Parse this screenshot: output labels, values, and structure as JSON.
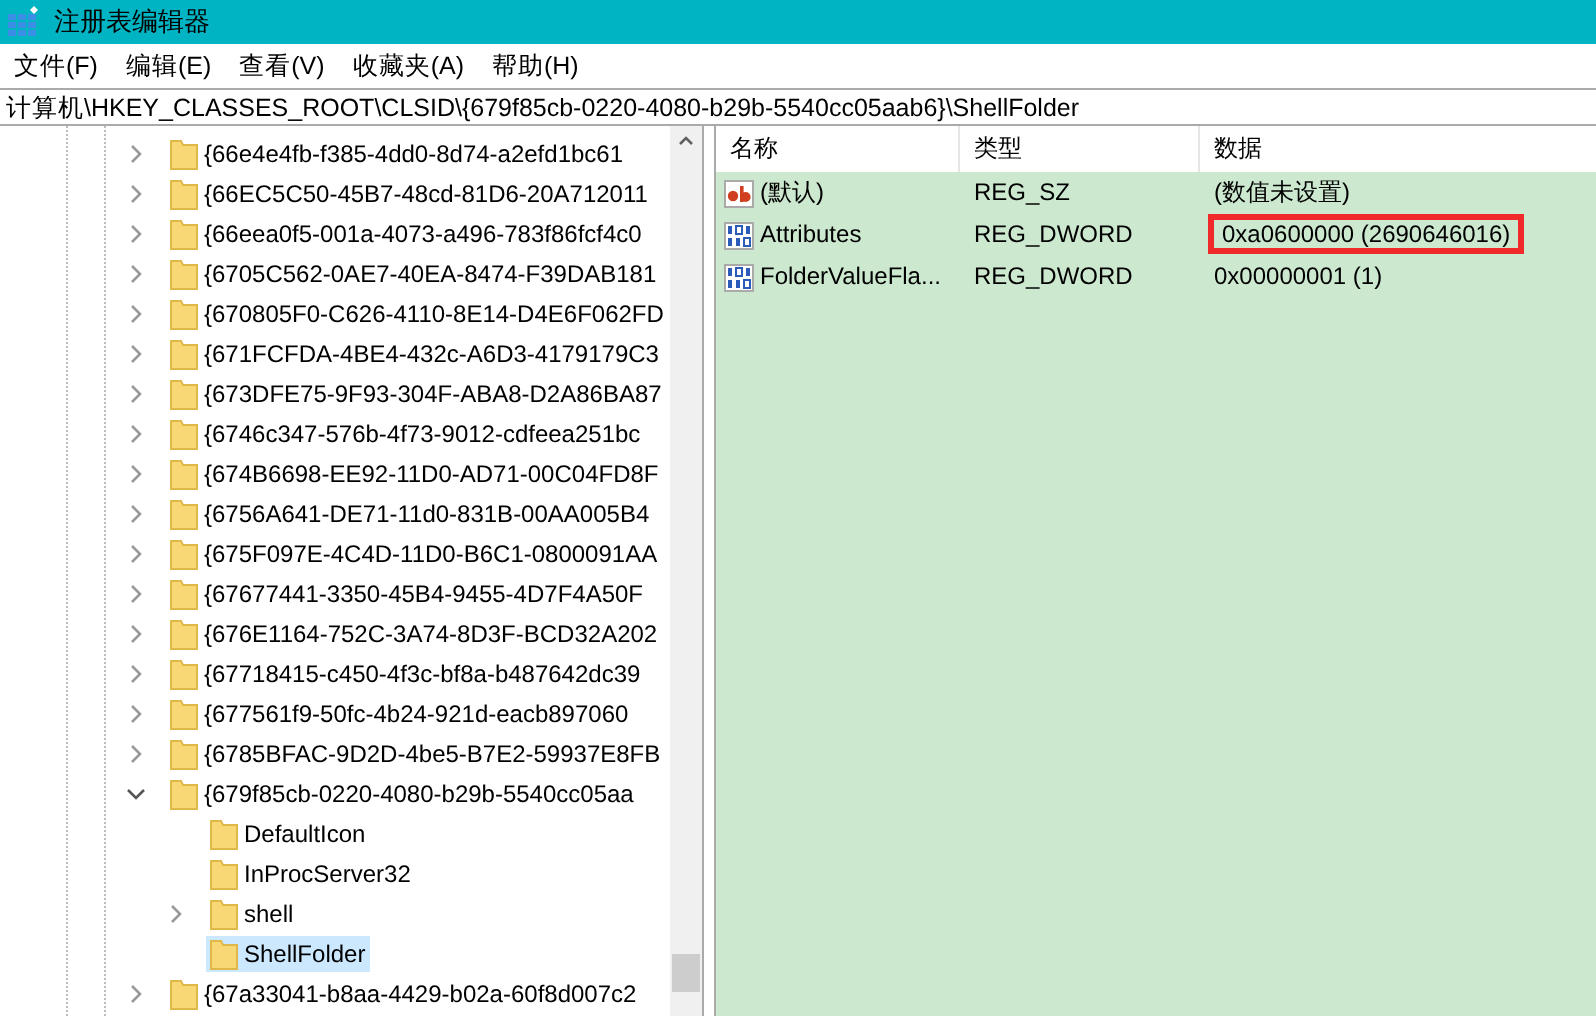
{
  "window": {
    "title": "注册表编辑器"
  },
  "menu": [
    "文件(F)",
    "编辑(E)",
    "查看(V)",
    "收藏夹(A)",
    "帮助(H)"
  ],
  "address": "计算机\\HKEY_CLASSES_ROOT\\CLSID\\{679f85cb-0220-4080-b29b-5540cc05aab6}\\ShellFolder",
  "tree": [
    {
      "label": "{66e4e4fb-f385-4dd0-8d74-a2efd1bc61",
      "expanded": false,
      "has_children": true,
      "selected": false
    },
    {
      "label": "{66EC5C50-45B7-48cd-81D6-20A712011",
      "expanded": false,
      "has_children": true,
      "selected": false
    },
    {
      "label": "{66eea0f5-001a-4073-a496-783f86fcf4c0",
      "expanded": false,
      "has_children": true,
      "selected": false
    },
    {
      "label": "{6705C562-0AE7-40EA-8474-F39DAB181",
      "expanded": false,
      "has_children": true,
      "selected": false
    },
    {
      "label": "{670805F0-C626-4110-8E14-D4E6F062FD",
      "expanded": false,
      "has_children": true,
      "selected": false
    },
    {
      "label": "{671FCFDA-4BE4-432c-A6D3-4179179C3",
      "expanded": false,
      "has_children": true,
      "selected": false
    },
    {
      "label": "{673DFE75-9F93-304F-ABA8-D2A86BA87",
      "expanded": false,
      "has_children": true,
      "selected": false
    },
    {
      "label": "{6746c347-576b-4f73-9012-cdfeea251bc",
      "expanded": false,
      "has_children": true,
      "selected": false
    },
    {
      "label": "{674B6698-EE92-11D0-AD71-00C04FD8F",
      "expanded": false,
      "has_children": true,
      "selected": false
    },
    {
      "label": "{6756A641-DE71-11d0-831B-00AA005B4",
      "expanded": false,
      "has_children": true,
      "selected": false
    },
    {
      "label": "{675F097E-4C4D-11D0-B6C1-0800091AA",
      "expanded": false,
      "has_children": true,
      "selected": false
    },
    {
      "label": "{67677441-3350-45B4-9455-4D7F4A50F",
      "expanded": false,
      "has_children": true,
      "selected": false
    },
    {
      "label": "{676E1164-752C-3A74-8D3F-BCD32A202",
      "expanded": false,
      "has_children": true,
      "selected": false
    },
    {
      "label": "{67718415-c450-4f3c-bf8a-b487642dc39",
      "expanded": false,
      "has_children": true,
      "selected": false
    },
    {
      "label": "{677561f9-50fc-4b24-921d-eacb897060",
      "expanded": false,
      "has_children": true,
      "selected": false
    },
    {
      "label": "{6785BFAC-9D2D-4be5-B7E2-59937E8FB",
      "expanded": false,
      "has_children": true,
      "selected": false
    },
    {
      "label": "{679f85cb-0220-4080-b29b-5540cc05aa",
      "expanded": true,
      "has_children": true,
      "selected": false,
      "children": [
        {
          "label": "DefaultIcon",
          "has_children": false,
          "selected": false
        },
        {
          "label": "InProcServer32",
          "has_children": false,
          "selected": false
        },
        {
          "label": "shell",
          "expanded": false,
          "has_children": true,
          "selected": false
        },
        {
          "label": "ShellFolder",
          "has_children": false,
          "selected": true
        }
      ]
    },
    {
      "label": "{67a33041-b8aa-4429-b02a-60f8d007c2",
      "expanded": false,
      "has_children": true,
      "selected": false
    }
  ],
  "values": {
    "columns": [
      "名称",
      "类型",
      "数据"
    ],
    "rows": [
      {
        "kind": "string",
        "name": "(默认)",
        "type": "REG_SZ",
        "data": "(数值未设置)",
        "highlighted": false
      },
      {
        "kind": "binary",
        "name": "Attributes",
        "type": "REG_DWORD",
        "data": "0xa0600000 (2690646016)",
        "highlighted": true
      },
      {
        "kind": "binary",
        "name": "FolderValueFla...",
        "type": "REG_DWORD",
        "data": "0x00000001 (1)",
        "highlighted": false
      }
    ]
  }
}
